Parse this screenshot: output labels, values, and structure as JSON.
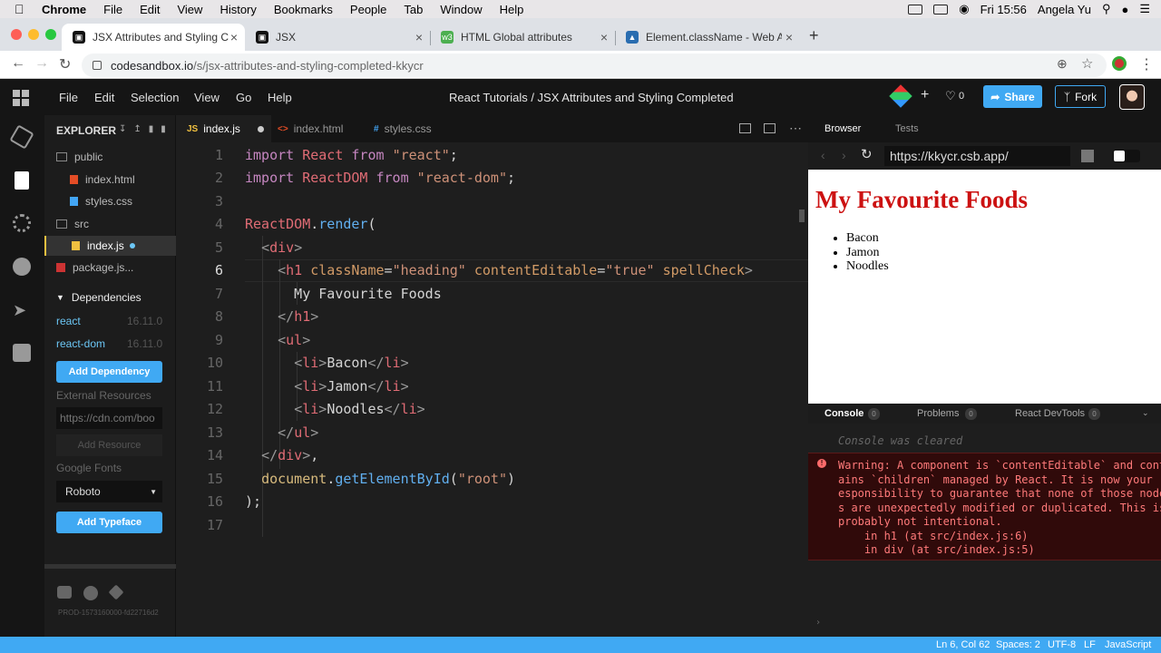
{
  "menubar": {
    "app": "Chrome",
    "items": [
      "File",
      "Edit",
      "View",
      "History",
      "Bookmarks",
      "People",
      "Tab",
      "Window",
      "Help"
    ],
    "clock": "Fri 15:56",
    "user": "Angela Yu"
  },
  "chrome": {
    "tabs": [
      {
        "title": "JSX Attributes and Styling Comp"
      },
      {
        "title": "JSX"
      },
      {
        "title": "HTML Global attributes"
      },
      {
        "title": "Element.className - Web APIs"
      }
    ],
    "url_domain": "codesandbox.io",
    "url_path": "/s/jsx-attributes-and-styling-completed-kkycr"
  },
  "header": {
    "menu": [
      "File",
      "Edit",
      "Selection",
      "View",
      "Go",
      "Help"
    ],
    "breadcrumb": "React Tutorials / JSX Attributes and Styling Completed",
    "likes": "0",
    "share": "Share",
    "fork": "Fork"
  },
  "sidebar": {
    "title": "EXPLORER",
    "files": [
      {
        "name": "public"
      },
      {
        "name": "index.html"
      },
      {
        "name": "styles.css"
      },
      {
        "name": "src"
      },
      {
        "name": "index.js"
      },
      {
        "name": "package.js..."
      }
    ],
    "dependencies_label": "Dependencies",
    "dependencies": [
      {
        "name": "react",
        "version": "16.11.0"
      },
      {
        "name": "react-dom",
        "version": "16.11.0"
      }
    ],
    "add_dependency": "Add Dependency",
    "external_label": "External Resources",
    "external_placeholder": "https://cdn.com/boo",
    "add_resource": "Add Resource",
    "fonts_label": "Google Fonts",
    "font_selected": "Roboto",
    "add_typeface": "Add Typeface",
    "build": "PROD-1573160000-fd22716d2"
  },
  "editor": {
    "tabs": [
      "index.js",
      "index.html",
      "styles.css"
    ],
    "lines": [
      "1",
      "2",
      "3",
      "4",
      "5",
      "6",
      "7",
      "8",
      "9",
      "10",
      "11",
      "12",
      "13",
      "14",
      "15",
      "16",
      "17"
    ],
    "current_line": 6
  },
  "preview": {
    "tabs": [
      "Browser",
      "Tests"
    ],
    "url": "https://kkycr.csb.app/",
    "heading": "My Favourite Foods",
    "items": [
      "Bacon",
      "Jamon",
      "Noodles"
    ]
  },
  "console": {
    "tabs": [
      {
        "label": "Console",
        "count": "0"
      },
      {
        "label": "Problems",
        "count": "0"
      },
      {
        "label": "React DevTools",
        "count": "0"
      }
    ],
    "cleared": "Console was cleared",
    "warning_lines": [
      "Warning: A component is `contentEditable` and cont",
      "ains `children` managed by React. It is now your r",
      "esponsibility to guarantee that none of those node",
      "s are unexpectedly modified or duplicated. This is",
      "probably not intentional.",
      "    in h1 (at src/index.js:6)",
      "    in div (at src/index.js:5)"
    ]
  },
  "status": {
    "position": "Ln 6, Col 62",
    "spaces": "Spaces: 2",
    "encoding": "UTF-8",
    "eol": "LF",
    "language": "JavaScript"
  },
  "colors": {
    "accent": "#40a9f3",
    "heading_red": "#cc1111",
    "warning_text": "#ff7a7a"
  }
}
